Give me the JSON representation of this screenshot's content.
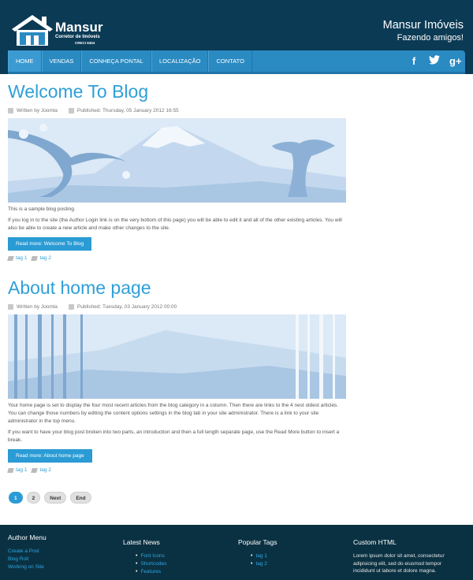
{
  "header": {
    "logo_text": "Mansur",
    "logo_sub": "Corretor de Imóveis",
    "logo_creci": "CRECI 6304",
    "site_title": "Mansur Imóveis",
    "site_subtitle": "Fazendo amigos!"
  },
  "nav": {
    "items": [
      {
        "label": "HOME"
      },
      {
        "label": "VENDAS"
      },
      {
        "label": "CONHEÇA PONTAL"
      },
      {
        "label": "LOCALIZAÇÃO"
      },
      {
        "label": "CONTATO"
      }
    ],
    "social": {
      "facebook": "f",
      "twitter": "t",
      "googleplus": "g+"
    }
  },
  "articles": [
    {
      "title": "Welcome To Blog",
      "author": "Written by Joomla",
      "published": "Published: Thursday, 05 January 2012 16:55",
      "paragraphs": [
        "This is a sample blog posting.",
        "If you log in to the site (the Author Login link is on the very bottom of this page) you will be able to edit it and all of the other existing articles. You will also be able to create a new article and make other changes to the site."
      ],
      "readmore": "Read more: Welcome To Blog",
      "tags": [
        "tag 1",
        "tag 2"
      ]
    },
    {
      "title": "About home page",
      "author": "Written by Joomla",
      "published": "Published: Tuesday, 03 January 2012 00:00",
      "paragraphs": [
        "Your home page is set to display the four most recent articles from the blog category in a column. Then there are links to the 4 nest oldest articles. You can change those numbers by editing the content options settings in the blog tab in your site administrator. There is a link to your site administrator in the top menu.",
        "If you want to have your blog post broken into two parts, an introduction and then a full length separate page, use the Read More button to insert a break."
      ],
      "readmore": "Read more: About home page",
      "tags": [
        "tag 1",
        "tag 2"
      ]
    }
  ],
  "pagination": [
    "1",
    "2",
    "Next",
    "End"
  ],
  "footer": {
    "author_menu": {
      "title": "Author Menu",
      "links": [
        "Create a Post",
        "Blog Roll",
        "Working on Site"
      ]
    },
    "latest_news": {
      "title": "Latest News",
      "links": [
        "Font Icons",
        "Shortcodes",
        "Features"
      ]
    },
    "popular_tags": {
      "title": "Popular Tags",
      "links": [
        "tag 1",
        "tag 2"
      ]
    },
    "custom_html": {
      "title": "Custom HTML",
      "text": "Lorem ipsum dolor sit amet, consectetur adipisicing elit, sed do eiusmod tempor incididunt ut labore et dolore magna."
    }
  },
  "colors": {
    "header_bg": "#0b3a55",
    "nav_bg": "#2a8ac2",
    "accent": "#2f9fd8",
    "footer_bg": "#0a3142"
  }
}
